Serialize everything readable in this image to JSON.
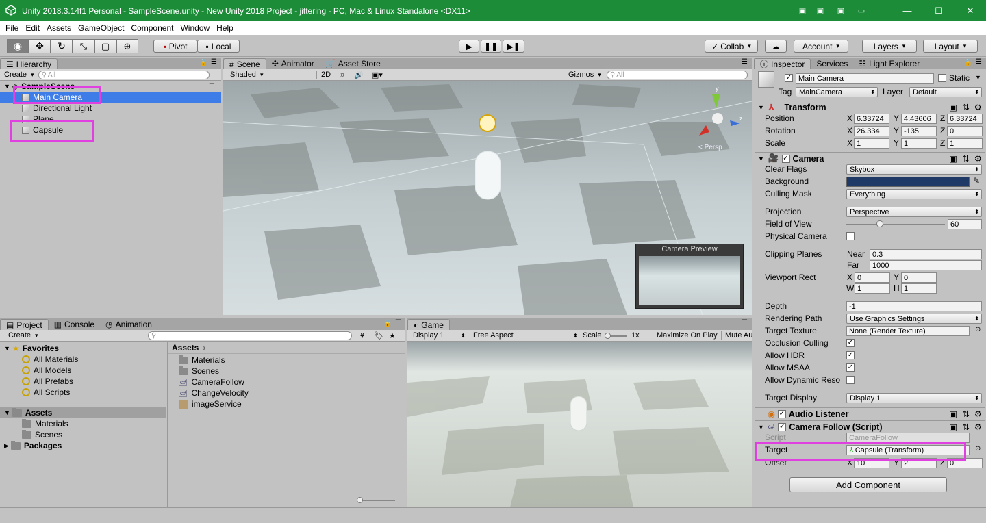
{
  "window": {
    "title": "Unity 2018.3.14f1 Personal - SampleScene.unity - New Unity 2018 Project - jittering - PC, Mac & Linux Standalone <DX11>",
    "controls": {
      "minimize": "—",
      "maximize": "☐",
      "close": "✕"
    }
  },
  "menu": [
    "File",
    "Edit",
    "Assets",
    "GameObject",
    "Component",
    "Window",
    "Help"
  ],
  "toolbar": {
    "pivot": "Pivot",
    "local": "Local",
    "collab": "Collab",
    "account": "Account",
    "layers": "Layers",
    "layout": "Layout"
  },
  "hierarchy": {
    "tab": "Hierarchy",
    "create": "Create",
    "search_placeholder": "All",
    "scene": "SampleScene",
    "items": [
      "Main Camera",
      "Directional Light",
      "Plane",
      "Capsule"
    ]
  },
  "scene_tabs": [
    "Scene",
    "Animator",
    "Asset Store"
  ],
  "scene_bar": {
    "shading": "Shaded",
    "mode_2d": "2D",
    "gizmos": "Gizmos",
    "search_placeholder": "All"
  },
  "scene_view": {
    "persp": "< Persp",
    "axis_y": "y",
    "axis_z": "z"
  },
  "camera_preview": "Camera Preview",
  "project_tabs": [
    "Project",
    "Console",
    "Animation"
  ],
  "project": {
    "create": "Create",
    "favorites": "Favorites",
    "favorite_items": [
      "All Materials",
      "All Models",
      "All Prefabs",
      "All Scripts"
    ],
    "assets": "Assets",
    "asset_folders": [
      "Materials",
      "Scenes"
    ],
    "packages": "Packages",
    "breadcrumb": "Assets",
    "files": [
      "Materials",
      "Scenes",
      "CameraFollow",
      "ChangeVelocity",
      "imageService"
    ]
  },
  "game": {
    "tab": "Game",
    "display": "Display 1",
    "aspect": "Free Aspect",
    "scale_label": "Scale",
    "scale_value": "1x",
    "maximize": "Maximize On Play",
    "mute": "Mute Au"
  },
  "inspector": {
    "tabs": [
      "Inspector",
      "Services",
      "Light Explorer"
    ],
    "name": "Main Camera",
    "static": "Static",
    "tag_label": "Tag",
    "tag": "MainCamera",
    "layer_label": "Layer",
    "layer": "Default",
    "transform": {
      "title": "Transform",
      "position_label": "Position",
      "position": [
        "6.33724",
        "4.43606",
        "6.33724"
      ],
      "rotation_label": "Rotation",
      "rotation": [
        "26.334",
        "-135",
        "0"
      ],
      "scale_label": "Scale",
      "scale": [
        "1",
        "1",
        "1"
      ],
      "axis": [
        "X",
        "Y",
        "Z"
      ]
    },
    "camera": {
      "title": "Camera",
      "clear_flags_label": "Clear Flags",
      "clear_flags": "Skybox",
      "background_label": "Background",
      "background_color": "#1f3a66",
      "culling_label": "Culling Mask",
      "culling": "Everything",
      "projection_label": "Projection",
      "projection": "Perspective",
      "fov_label": "Field of View",
      "fov": "60",
      "physical_label": "Physical Camera",
      "clipping_label": "Clipping Planes",
      "near_label": "Near",
      "near": "0.3",
      "far_label": "Far",
      "far": "1000",
      "viewport_label": "Viewport Rect",
      "vp_x_label": "X",
      "vp_x": "0",
      "vp_y_label": "Y",
      "vp_y": "0",
      "vp_w_label": "W",
      "vp_w": "1",
      "vp_h_label": "H",
      "vp_h": "1",
      "depth_label": "Depth",
      "depth": "-1",
      "rendering_label": "Rendering Path",
      "rendering": "Use Graphics Settings",
      "target_texture_label": "Target Texture",
      "target_texture": "None (Render Texture)",
      "occlusion_label": "Occlusion Culling",
      "hdr_label": "Allow HDR",
      "msaa_label": "Allow MSAA",
      "dynres_label": "Allow Dynamic Reso",
      "target_display_label": "Target Display",
      "target_display": "Display 1"
    },
    "audio_listener": "Audio Listener",
    "camera_follow": {
      "title": "Camera Follow (Script)",
      "script_label": "Script",
      "script": "CameraFollow",
      "target_label": "Target",
      "target": "Capsule (Transform)",
      "offset_label": "Offset",
      "offset": [
        "10",
        "2",
        "0"
      ]
    },
    "add_component": "Add Component"
  }
}
